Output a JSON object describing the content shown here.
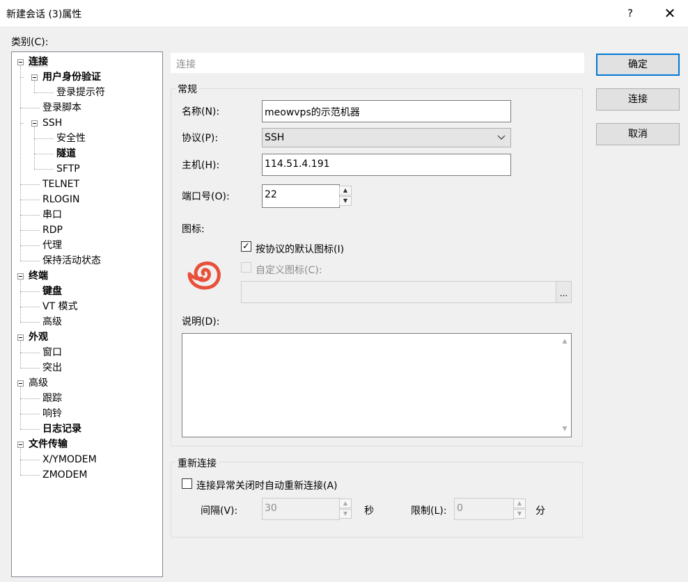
{
  "window": {
    "title": "新建会话 (3)属性",
    "help": "?",
    "close": "✕"
  },
  "category_label": "类别(C):",
  "tree": [
    {
      "label": "连接",
      "bold": true,
      "level": 0,
      "expander": true,
      "selected": true
    },
    {
      "label": "用户身份验证",
      "bold": true,
      "level": 1,
      "expander": true
    },
    {
      "label": "登录提示符",
      "bold": false,
      "level": 2
    },
    {
      "label": "登录脚本",
      "bold": false,
      "level": 1
    },
    {
      "label": "SSH",
      "bold": false,
      "level": 1,
      "expander": true
    },
    {
      "label": "安全性",
      "bold": false,
      "level": 2
    },
    {
      "label": "隧道",
      "bold": true,
      "level": 2
    },
    {
      "label": "SFTP",
      "bold": false,
      "level": 2
    },
    {
      "label": "TELNET",
      "bold": false,
      "level": 1
    },
    {
      "label": "RLOGIN",
      "bold": false,
      "level": 1
    },
    {
      "label": "串口",
      "bold": false,
      "level": 1
    },
    {
      "label": "RDP",
      "bold": false,
      "level": 1
    },
    {
      "label": "代理",
      "bold": false,
      "level": 1
    },
    {
      "label": "保持活动状态",
      "bold": false,
      "level": 1
    },
    {
      "label": "终端",
      "bold": true,
      "level": 0,
      "expander": true
    },
    {
      "label": "键盘",
      "bold": true,
      "level": 1
    },
    {
      "label": "VT 模式",
      "bold": false,
      "level": 1
    },
    {
      "label": "高级",
      "bold": false,
      "level": 1
    },
    {
      "label": "外观",
      "bold": true,
      "level": 0,
      "expander": true
    },
    {
      "label": "窗口",
      "bold": false,
      "level": 1
    },
    {
      "label": "突出",
      "bold": false,
      "level": 1
    },
    {
      "label": "高级",
      "bold": false,
      "level": 0,
      "expander": true
    },
    {
      "label": "跟踪",
      "bold": false,
      "level": 1
    },
    {
      "label": "响铃",
      "bold": false,
      "level": 1
    },
    {
      "label": "日志记录",
      "bold": true,
      "level": 1
    },
    {
      "label": "文件传输",
      "bold": true,
      "level": 0,
      "expander": true
    },
    {
      "label": "X/YMODEM",
      "bold": false,
      "level": 1
    },
    {
      "label": "ZMODEM",
      "bold": false,
      "level": 1
    }
  ],
  "panel_header": "连接",
  "general": {
    "title": "常规",
    "name_label": "名称(N):",
    "name_value": "meowvps的示范机器",
    "protocol_label": "协议(P):",
    "protocol_value": "SSH",
    "host_label": "主机(H):",
    "host_value": "114.51.4.191",
    "port_label": "端口号(O):",
    "port_value": "22",
    "icon_label": "图标:",
    "default_icon_label": "按协议的默认图标(I)",
    "default_icon_checked": true,
    "custom_icon_label": "自定义图标(C):",
    "custom_icon_checked": false,
    "custom_icon_path": "",
    "browse_label": "...",
    "description_label": "说明(D):",
    "description_value": ""
  },
  "reconnect": {
    "title": "重新连接",
    "auto_label": "连接异常关闭时自动重新连接(A)",
    "auto_checked": false,
    "interval_label": "间隔(V):",
    "interval_value": "30",
    "interval_unit": "秒",
    "limit_label": "限制(L):",
    "limit_value": "0",
    "limit_unit": "分"
  },
  "buttons": {
    "ok": "确定",
    "connect": "连接",
    "cancel": "取消"
  },
  "colors": {
    "accent": "#0078d7",
    "icon": "#e8503a"
  }
}
